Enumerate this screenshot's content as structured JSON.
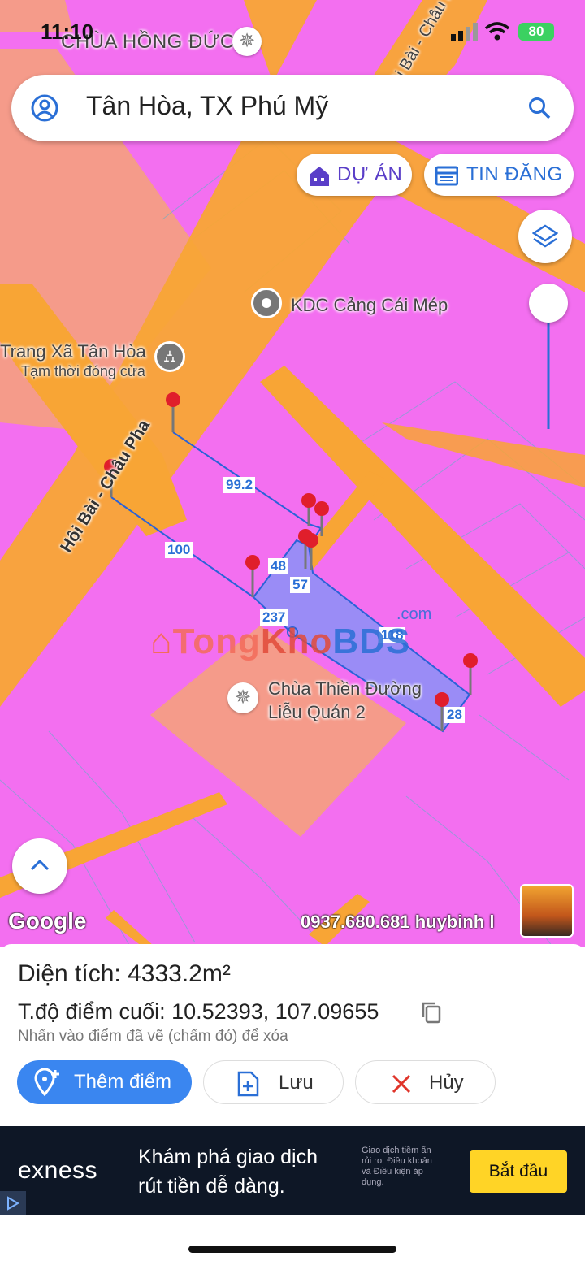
{
  "status_bar": {
    "time": "11:10",
    "battery": "80"
  },
  "search": {
    "query": "Tân Hòa, TX Phú Mỹ"
  },
  "chips": {
    "project_label": "DỰ ÁN",
    "listing_label": "TIN ĐĂNG"
  },
  "map": {
    "places": {
      "temple_top": "CHÙA HỒNG ĐỨC",
      "road_top": "Hội Bài - Châu Pha",
      "kdc": "KDC Cảng Cái Mép",
      "cemetery_name": "Trang Xã Tân Hòa",
      "cemetery_status": "Tạm thời đóng cửa",
      "road_main": "Hội Bài - Châu Pha",
      "temple_line1": "Chùa Thiền Đường",
      "temple_line2": "Liễu Quán 2"
    },
    "segments": [
      "99.2",
      "100",
      "48",
      "57",
      "237",
      "118",
      "28"
    ],
    "watermark": {
      "part1": "Tong",
      "part2": "Kho",
      "part3": "BDS",
      "suffix": ".com"
    },
    "google_logo": "Google",
    "attribution": "0937.680.681 huybinh l"
  },
  "panel": {
    "area_label": "Diện tích:",
    "area_value": "4333.2m²",
    "coord_label": "T.độ điểm cuối:",
    "coord_value": "10.52393, 107.09655",
    "hint": "Nhấn vào điểm đã vẽ (chấm đỏ) để xóa",
    "add_point": "Thêm điểm",
    "save": "Lưu",
    "cancel": "Hủy"
  },
  "ad": {
    "brand": "exness",
    "headline_line1": "Khám phá giao dịch",
    "headline_line2": "rút tiền dễ dàng.",
    "disclaimer": "Giao dịch tiềm ẩn rủi ro. Điều khoản và Điều kiện áp dụng.",
    "cta": "Bắt đầu"
  },
  "colors": {
    "accent": "#3a86f0",
    "zone_pink": "#f36ff0",
    "road": "#f8a535",
    "salmon": "#f59b8a",
    "polygon": "#9a8cf6",
    "ad_cta": "#ffd426"
  }
}
